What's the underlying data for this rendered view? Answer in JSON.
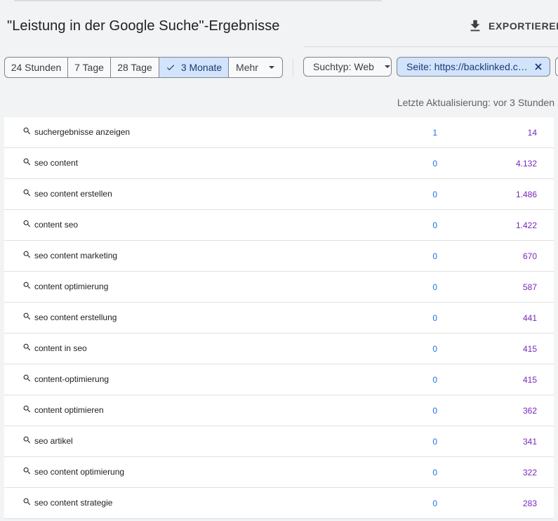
{
  "header": {
    "title": "\"Leistung in der Google Suche\"-Ergebnisse",
    "export_label": "EXPORTIEREN"
  },
  "date_range": {
    "options": [
      "24 Stunden",
      "7 Tage",
      "28 Tage",
      "3 Monate",
      "Mehr"
    ],
    "selected": "3 Monate"
  },
  "filters": {
    "search_type": "Suchtyp: Web",
    "page": "Seite: https://backlinked.co..."
  },
  "status": {
    "last_update": "Letzte Aktualisierung: vor 3 Stunden"
  },
  "colors": {
    "clicks": "#1a73e8",
    "impressions": "#7627bb",
    "selected_chip": "#d2e3fc"
  },
  "rows": [
    {
      "query": "suchergebnisse anzeigen",
      "clicks": "1",
      "impressions": "14"
    },
    {
      "query": "seo content",
      "clicks": "0",
      "impressions": "4.132"
    },
    {
      "query": "seo content erstellen",
      "clicks": "0",
      "impressions": "1.486"
    },
    {
      "query": "content seo",
      "clicks": "0",
      "impressions": "1.422"
    },
    {
      "query": "seo content marketing",
      "clicks": "0",
      "impressions": "670"
    },
    {
      "query": "content optimierung",
      "clicks": "0",
      "impressions": "587"
    },
    {
      "query": "seo content erstellung",
      "clicks": "0",
      "impressions": "441"
    },
    {
      "query": "content in seo",
      "clicks": "0",
      "impressions": "415"
    },
    {
      "query": "content-optimierung",
      "clicks": "0",
      "impressions": "415"
    },
    {
      "query": "content optimieren",
      "clicks": "0",
      "impressions": "362"
    },
    {
      "query": "seo artikel",
      "clicks": "0",
      "impressions": "341"
    },
    {
      "query": "seo content optimierung",
      "clicks": "0",
      "impressions": "322"
    },
    {
      "query": "seo content strategie",
      "clicks": "0",
      "impressions": "283"
    }
  ]
}
